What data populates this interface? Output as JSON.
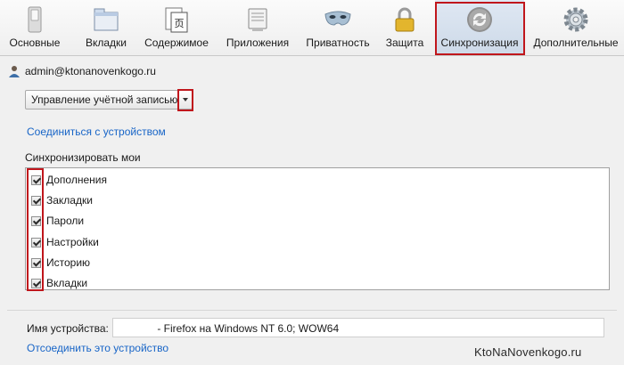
{
  "toolbar": {
    "tabs": [
      {
        "label": "Основные",
        "icon": "switch-icon"
      },
      {
        "label": "Вкладки",
        "icon": "tabs-window-icon"
      },
      {
        "label": "Содержимое",
        "icon": "content-page-icon"
      },
      {
        "label": "Приложения",
        "icon": "applications-icon"
      },
      {
        "label": "Приватность",
        "icon": "privacy-mask-icon"
      },
      {
        "label": "Защита",
        "icon": "padlock-icon"
      },
      {
        "label": "Синхронизация",
        "icon": "sync-arrows-icon",
        "selected": true
      },
      {
        "label": "Дополнительные",
        "icon": "gear-icon"
      }
    ]
  },
  "account": {
    "email": "admin@ktonanovenkogo.ru",
    "icon": "user-icon"
  },
  "dropdown": {
    "value": "Управление учётной записью"
  },
  "connect_link": "Соединиться с устройством",
  "sync": {
    "title": "Синхронизировать мои",
    "items": [
      {
        "label": "Дополнения",
        "checked": true
      },
      {
        "label": "Закладки",
        "checked": true
      },
      {
        "label": "Пароли",
        "checked": true
      },
      {
        "label": "Настройки",
        "checked": true
      },
      {
        "label": "Историю",
        "checked": true
      },
      {
        "label": "Вкладки",
        "checked": true
      }
    ]
  },
  "device": {
    "label": "Имя устройства:",
    "value": "- Firefox на Windows NT 6.0; WOW64",
    "disconnect_link": "Отсоединить это устройство"
  },
  "watermark": "KtoNaNovenkogo.ru",
  "colors": {
    "highlight": "#c0161c",
    "link": "#1865c7",
    "selected_tab": "#cdd9e8"
  }
}
